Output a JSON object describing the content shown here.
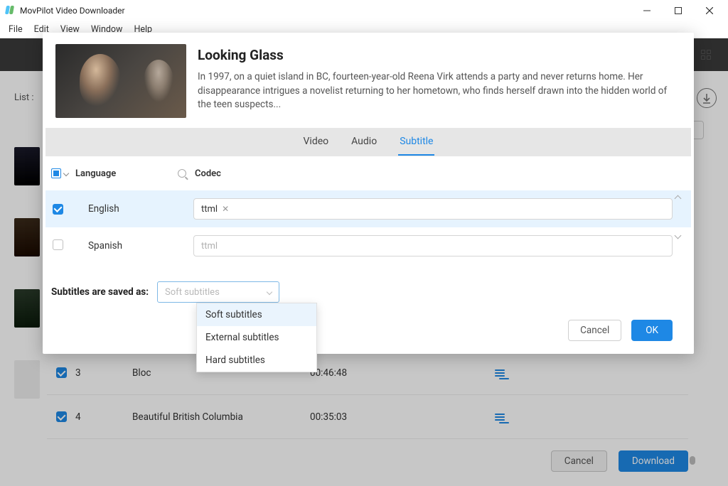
{
  "app_title": "MovPilot Video Downloader",
  "menu": {
    "file": "File",
    "edit": "Edit",
    "view": "View",
    "window": "Window",
    "help": "Help"
  },
  "backdrop": {
    "list_label": "List :",
    "rows": [
      {
        "num": "3",
        "title": "Bloc",
        "duration": "00:46:48"
      },
      {
        "num": "4",
        "title": "Beautiful British Columbia",
        "duration": "00:35:03"
      }
    ],
    "cancel": "Cancel",
    "download": "Download"
  },
  "modal": {
    "title": "Looking Glass",
    "description": "In 1997, on a quiet island in BC, fourteen-year-old Reena Virk attends a party and never returns home. Her disappearance intrigues a novelist returning to her hometown, who finds herself drawn into the hidden world of the teen suspects...",
    "tabs": {
      "video": "Video",
      "audio": "Audio",
      "subtitle": "Subtitle"
    },
    "headers": {
      "language": "Language",
      "codec": "Codec"
    },
    "rows": [
      {
        "lang": "English",
        "codec": "ttml",
        "checked": true
      },
      {
        "lang": "Spanish",
        "codec": "ttml",
        "checked": false
      }
    ],
    "save_as_label": "Subtitles are saved as:",
    "save_as_value": "Soft subtitles",
    "dropdown": [
      "Soft subtitles",
      "External subtitles",
      "Hard subtitles"
    ],
    "cancel": "Cancel",
    "ok": "OK"
  }
}
